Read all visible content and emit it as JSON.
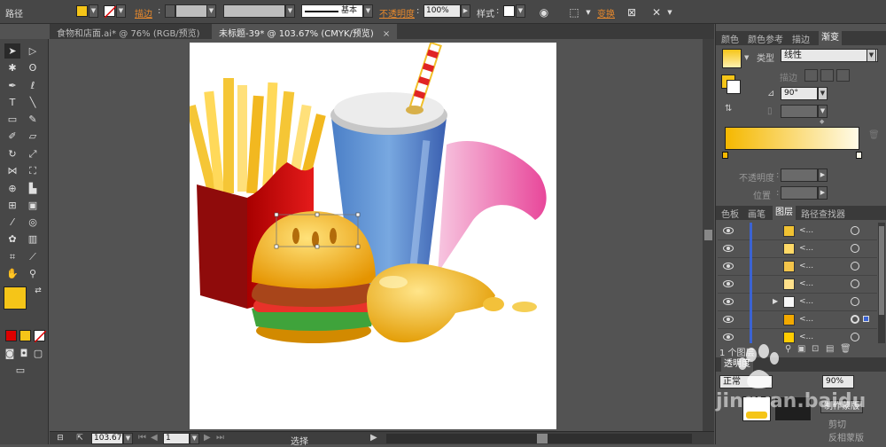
{
  "control_bar": {
    "selection_type": "路径",
    "stroke_label": "描边",
    "stroke_weight_value": "",
    "brush_value": "",
    "stroke_profile": "基本",
    "opacity_label": "不透明度",
    "opacity_value": "100%",
    "style_label": "样式",
    "transform_label": "变换",
    "fill_color": "#f5c518"
  },
  "doc_tabs": [
    {
      "label": "食物和店面.ai* @ 76% (RGB/预览)",
      "close": ""
    },
    {
      "label": "未标题-39* @ 103.67% (CMYK/预览)",
      "close": "×"
    }
  ],
  "status_bar": {
    "zoom": "103.67",
    "page": "1",
    "tool_label": "选择"
  },
  "right_panel": {
    "tabs_top": [
      "颜色",
      "颜色参考",
      "描边",
      "渐变"
    ],
    "gradient": {
      "type_label": "类型",
      "type_value": "线性",
      "stroke_label": "描边",
      "angle_value": "90°",
      "opacity_label": "不透明度",
      "position_label": "位置",
      "start_color": "#f5b800",
      "end_color": "#fffbe8"
    },
    "tabs_mid": [
      "色板",
      "画笔",
      "图层",
      "路径查找器"
    ],
    "layers": [
      {
        "name": "<...",
        "thumb": "#f1c232",
        "expand": ""
      },
      {
        "name": "<...",
        "thumb": "#ffd966",
        "expand": ""
      },
      {
        "name": "<...",
        "thumb": "#f3c44a",
        "expand": ""
      },
      {
        "name": "<...",
        "thumb": "#ffe08a",
        "expand": ""
      },
      {
        "name": "<...",
        "thumb": "#f7f7f7",
        "expand": "▶"
      },
      {
        "name": "<...",
        "thumb": "#f2a900",
        "expand": "",
        "selected": true
      },
      {
        "name": "<...",
        "thumb": "#ffcc00",
        "expand": ""
      },
      {
        "name": "<...",
        "thumb": "#e74c3c",
        "expand": ""
      }
    ],
    "layers_footer": "1 个图层",
    "transparency_tab": "透明度",
    "blend_mode": "正常",
    "transparency_opacity": "90%",
    "make_mask_button": "制作蒙版",
    "clip_label": "剪切",
    "invert_mask_label": "反相蒙版"
  },
  "watermark": "jingyan.baidu"
}
